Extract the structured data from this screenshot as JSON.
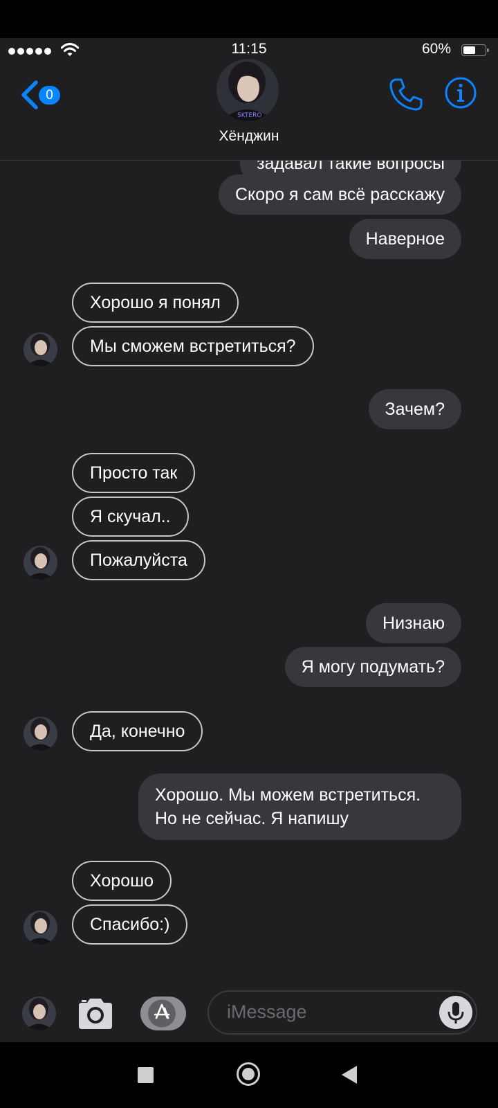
{
  "status_bar": {
    "time": "11:15",
    "battery_text": "60%",
    "battery_level": 0.6,
    "signal_dots": 5
  },
  "header": {
    "back_badge": "0",
    "contact_name": "Хёнджин",
    "accent_color": "#0a84ff"
  },
  "messages": [
    {
      "side": "out",
      "text": "задавал такие вопросы"
    },
    {
      "side": "out",
      "text": "Скоро я сам всё расскажу"
    },
    {
      "side": "out",
      "text": "Наверное"
    },
    {
      "side": "in",
      "text": "Хорошо я понял"
    },
    {
      "side": "in",
      "text": "Мы сможем встретиться?"
    },
    {
      "side": "out",
      "text": "Зачем?"
    },
    {
      "side": "in",
      "text": "Просто так"
    },
    {
      "side": "in",
      "text": "Я скучал.."
    },
    {
      "side": "in",
      "text": "Пожалуйста"
    },
    {
      "side": "out",
      "text": "Низнаю"
    },
    {
      "side": "out",
      "text": "Я могу подумать?"
    },
    {
      "side": "in",
      "text": "Да, конечно"
    },
    {
      "side": "out",
      "text": "Хорошо. Мы можем встретиться. Но не сейчас. Я напишу"
    },
    {
      "side": "in",
      "text": "Хорошо"
    },
    {
      "side": "in",
      "text": "Спасибо:)"
    }
  ],
  "input": {
    "placeholder": "iMessage"
  },
  "icons": {
    "back": "chevron-left-icon",
    "call": "phone-icon",
    "info": "info-icon",
    "camera": "camera-icon",
    "appstore": "app-store-icon",
    "mic": "microphone-icon"
  }
}
